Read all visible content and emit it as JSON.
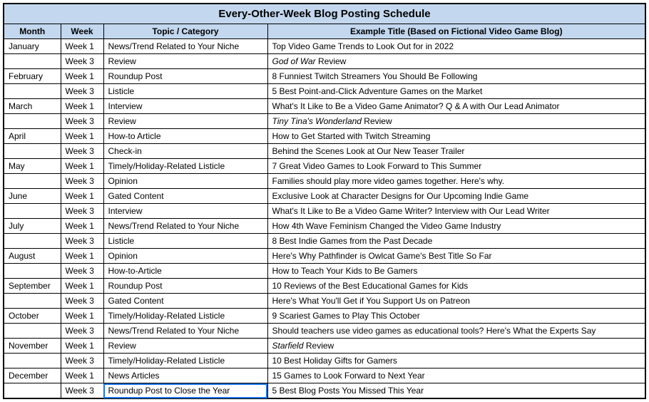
{
  "title": "Every-Other-Week Blog Posting Schedule",
  "headers": {
    "month": "Month",
    "week": "Week",
    "topic": "Topic / Category",
    "example": "Example Title (Based on Fictional Video Game Blog)"
  },
  "rows": [
    {
      "month": "January",
      "week": "Week 1",
      "topic": "News/Trend Related to Your Niche",
      "title": "Top Video Game Trends to Look Out for in 2022",
      "italic": ""
    },
    {
      "month": "",
      "week": "Week 3",
      "topic": "Review",
      "title": " Review",
      "italic": "God of War"
    },
    {
      "month": "February",
      "week": "Week 1",
      "topic": "Roundup Post",
      "title": "8 Funniest Twitch Streamers You Should Be Following",
      "italic": ""
    },
    {
      "month": "",
      "week": "Week 3",
      "topic": "Listicle",
      "title": "5 Best Point-and-Click Adventure Games on the Market",
      "italic": ""
    },
    {
      "month": "March",
      "week": "Week 1",
      "topic": "Interview",
      "title": "What's It Like to Be a Video Game Animator? Q & A with Our Lead Animator",
      "italic": ""
    },
    {
      "month": "",
      "week": "Week 3",
      "topic": "Review",
      "title": " Review",
      "italic": "Tiny Tina's Wonderland"
    },
    {
      "month": "April",
      "week": "Week 1",
      "topic": "How-to Article",
      "title": "How to Get Started with Twitch Streaming",
      "italic": ""
    },
    {
      "month": "",
      "week": "Week 3",
      "topic": "Check-in",
      "title": "Behind the Scenes Look at Our New Teaser Trailer",
      "italic": ""
    },
    {
      "month": "May",
      "week": "Week 1",
      "topic": "Timely/Holiday-Related Listicle",
      "title": "7 Great Video Games to Look Forward to This Summer",
      "italic": ""
    },
    {
      "month": "",
      "week": "Week 3",
      "topic": "Opinion",
      "title": "Families should play more video games together. Here's why.",
      "italic": ""
    },
    {
      "month": "June",
      "week": "Week 1",
      "topic": "Gated Content",
      "title": "Exclusive Look at Character Designs for Our Upcoming Indie Game",
      "italic": ""
    },
    {
      "month": "",
      "week": "Week 3",
      "topic": "Interview",
      "title": "What's It Like to Be a Video Game Writer? Interview with Our Lead Writer",
      "italic": ""
    },
    {
      "month": "July",
      "week": "Week 1",
      "topic": "News/Trend Related to Your Niche",
      "title": "How 4th Wave Feminism Changed the Video Game Industry",
      "italic": ""
    },
    {
      "month": "",
      "week": "Week 3",
      "topic": "Listicle",
      "title": "8 Best Indie Games from the Past Decade",
      "italic": ""
    },
    {
      "month": "August",
      "week": "Week 1",
      "topic": "Opinion",
      "title": "Here's Why Pathfinder is Owlcat Game's Best Title So Far",
      "italic": ""
    },
    {
      "month": "",
      "week": "Week 3",
      "topic": "How-to-Article",
      "title": "How to Teach Your Kids to Be Gamers",
      "italic": ""
    },
    {
      "month": "September",
      "week": "Week 1",
      "topic": "Roundup Post",
      "title": "10 Reviews of the Best Educational Games for Kids",
      "italic": ""
    },
    {
      "month": "",
      "week": "Week 3",
      "topic": "Gated Content",
      "title": "Here's What You'll Get if You Support Us on Patreon",
      "italic": ""
    },
    {
      "month": "October",
      "week": "Week 1",
      "topic": "Timely/Holiday-Related Listicle",
      "title": "9 Scariest Games to Play This October",
      "italic": ""
    },
    {
      "month": "",
      "week": "Week 3",
      "topic": "News/Trend Related to Your Niche",
      "title": "Should teachers use video games as educational tools? Here's What the Experts Say",
      "italic": ""
    },
    {
      "month": "November",
      "week": "Week 1",
      "topic": "Review",
      "title": " Review",
      "italic": "Starfield"
    },
    {
      "month": "",
      "week": "Week 3",
      "topic": "Timely/Holiday-Related Listicle",
      "title": "10 Best Holiday Gifts for Gamers",
      "italic": ""
    },
    {
      "month": "December",
      "week": "Week 1",
      "topic": "News Articles",
      "title": "15 Games to Look Forward to Next Year",
      "italic": ""
    },
    {
      "month": "",
      "week": "Week 3",
      "topic": "Roundup Post to Close the Year",
      "title": "5 Best Blog Posts You Missed This Year",
      "italic": "",
      "selected": true
    }
  ]
}
